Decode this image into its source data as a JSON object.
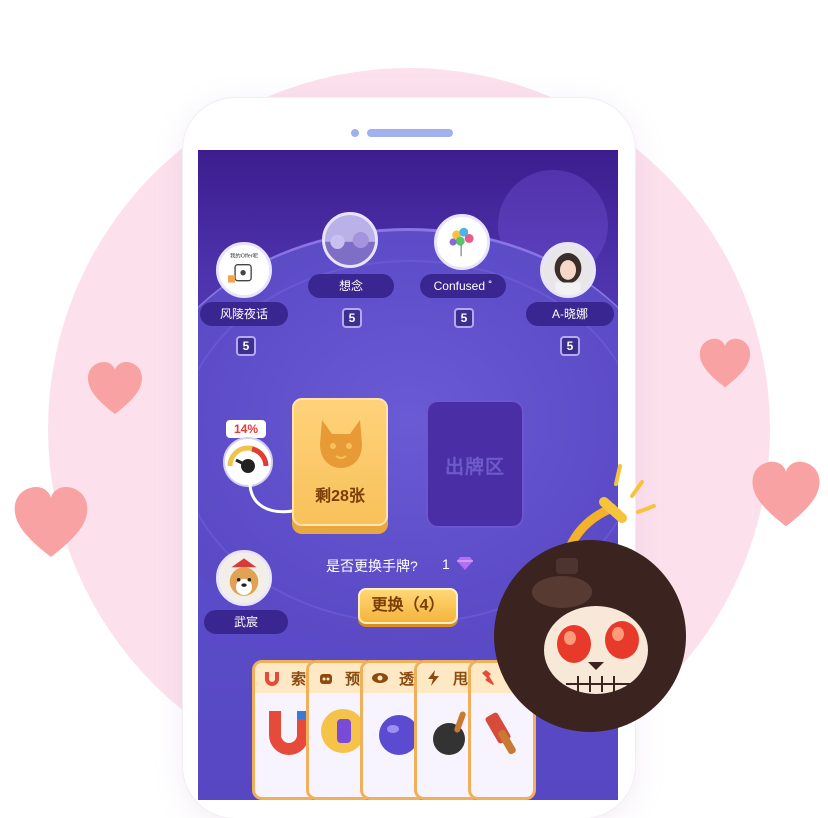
{
  "players_top": [
    {
      "name": "风陵夜话",
      "cards": "5"
    },
    {
      "name": "想念",
      "cards": "5"
    },
    {
      "name": "Confused ˚",
      "cards": "5"
    },
    {
      "name": "A-晓娜",
      "cards": "5"
    }
  ],
  "self_player": {
    "name": "武宸"
  },
  "avatar_texts": {
    "player1_mini": "我的Offer呢"
  },
  "deck": {
    "remaining_label": "剩28张"
  },
  "play_zone": {
    "label": "出牌区"
  },
  "gauge": {
    "percent_label": "14%"
  },
  "swap": {
    "question": "是否更换手牌?",
    "cost": "1",
    "button_label": "更换（4）"
  },
  "item_cards": [
    {
      "label": "索",
      "icon": "magnet-icon"
    },
    {
      "label": "预",
      "icon": "robot-icon"
    },
    {
      "label": "透",
      "icon": "eye-icon"
    },
    {
      "label": "甩",
      "icon": "pan-icon"
    },
    {
      "label": "",
      "icon": "tool-icon"
    }
  ],
  "colors": {
    "background_circle": "#fce1ec",
    "heart": "#f9a2a4",
    "screen_purple": "#5a4bc8",
    "deck_gold": "#f8c15b",
    "name_pill": "#3a2690"
  }
}
